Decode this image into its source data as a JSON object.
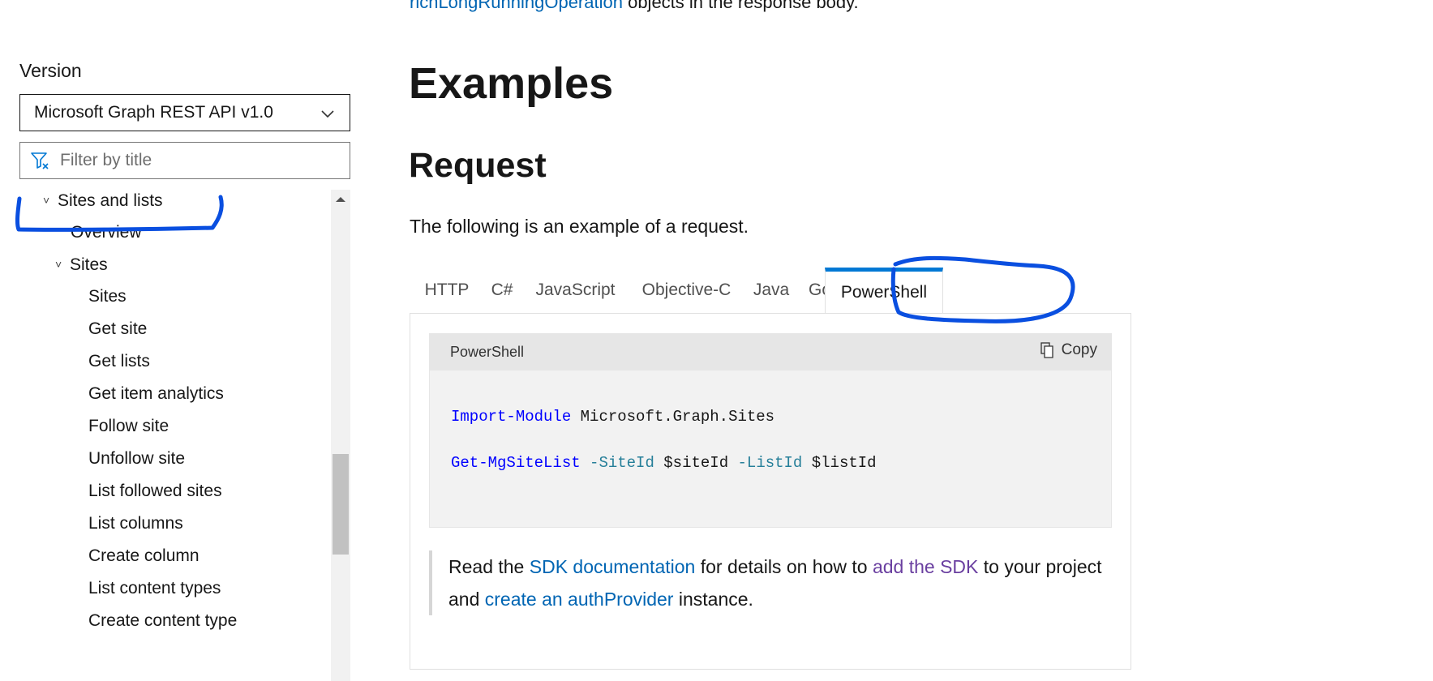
{
  "sidebar": {
    "version_label": "Version",
    "version_selected": "Microsoft Graph REST API v1.0",
    "filter_placeholder": "Filter by title",
    "toc": [
      {
        "label": "Sites and lists",
        "caret": "˅"
      },
      {
        "label": "Overview"
      },
      {
        "label": "Sites",
        "caret": "˅"
      },
      {
        "label": "Sites"
      },
      {
        "label": "Get site"
      },
      {
        "label": "Get lists"
      },
      {
        "label": "Get item analytics"
      },
      {
        "label": "Follow site"
      },
      {
        "label": "Unfollow site"
      },
      {
        "label": "List followed sites"
      },
      {
        "label": "List columns"
      },
      {
        "label": "Create column"
      },
      {
        "label": "List content types"
      },
      {
        "label": "Create content type"
      }
    ]
  },
  "main": {
    "top_line_link": "richLongRunningOperation",
    "top_line_text": " objects in the response body.",
    "examples_heading": "Examples",
    "request_heading": "Request",
    "intro_text": "The following is an example of a request.",
    "tabs": [
      "HTTP",
      "C#",
      "JavaScript",
      "Objective-C",
      "Java",
      "Go",
      "PowerShell"
    ],
    "active_tab": "PowerShell",
    "code": {
      "language": "PowerShell",
      "copy_label": "Copy",
      "line1_cmd": "Import-Module",
      "line1_arg": " Microsoft.Graph.Sites",
      "line2_cmd": "Get-MgSiteList",
      "line2_p1": "-SiteId",
      "line2_v1": "$siteId",
      "line2_p2": "-ListId",
      "line2_v2": "$listId"
    },
    "note": {
      "t1": "Read the ",
      "l1": "SDK documentation",
      "t2": " for details on how to ",
      "l2": "add the SDK",
      "t3": " to your project and ",
      "l3": "create an authProvider",
      "t4": " instance."
    }
  },
  "colors": {
    "link": "#0065b3",
    "visited_link": "#6a3fa0",
    "active_tab_accent": "#0078d4",
    "annotation": "#0a4fe0"
  }
}
